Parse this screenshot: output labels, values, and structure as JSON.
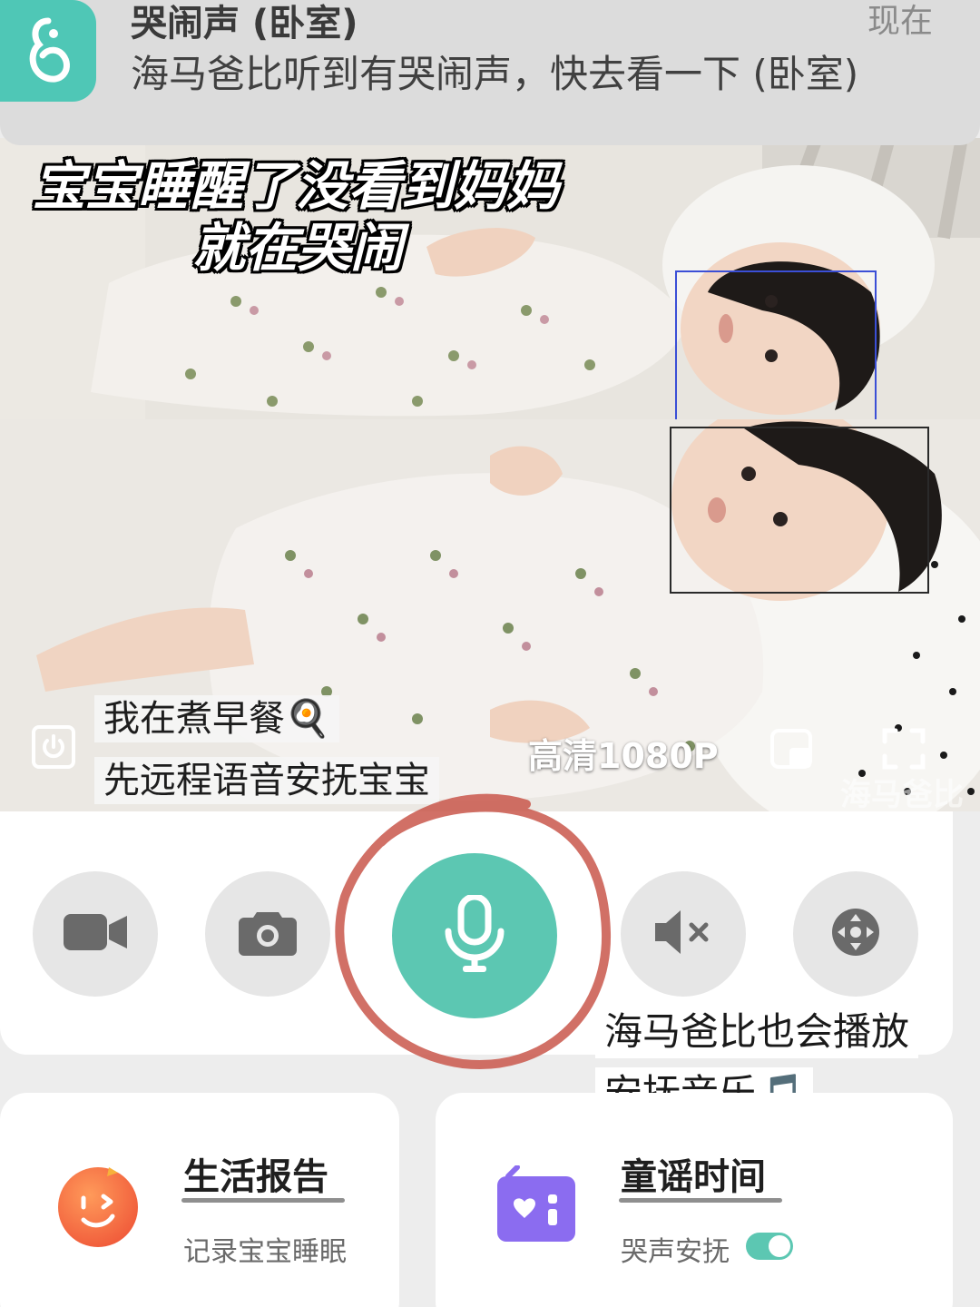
{
  "notification": {
    "app_icon": "haimababy-app-icon",
    "title": "哭闹声 (卧室)",
    "body": "海马爸比听到有哭闹声，快去看一下 (卧室)",
    "time": "现在"
  },
  "video": {
    "caption_line1": "宝宝睡醒了没看到妈妈",
    "caption_line2": "就在哭闹",
    "note_line1": "我在煮早餐🍳",
    "note_line2": "先远程语音安抚宝宝",
    "quality_label": "高清1080P",
    "watermark": "海马爸比",
    "face_box_colors": [
      "#3b4fd6",
      "#2a2a2a"
    ]
  },
  "controls": {
    "buttons": [
      {
        "name": "record-button",
        "icon": "video-camera-icon"
      },
      {
        "name": "snapshot-button",
        "icon": "camera-icon"
      },
      {
        "name": "talk-button",
        "icon": "microphone-icon",
        "active": true,
        "color": "#5cc7b2"
      },
      {
        "name": "mute-button",
        "icon": "speaker-muted-icon"
      },
      {
        "name": "pan-tilt-button",
        "icon": "direction-pad-icon"
      }
    ],
    "annotation_line1": "海马爸比也会播放",
    "annotation_line2": "安抚音乐🎵",
    "highlight_color": "#c9574b"
  },
  "cards": {
    "life_report": {
      "title": "生活报告",
      "subtitle": "记录宝宝睡眠",
      "icon": "smiley-wink-icon"
    },
    "nursery_rhymes": {
      "title": "童谣时间",
      "subtitle": "哭声安抚",
      "icon": "radio-icon",
      "toggle_on": true
    }
  }
}
